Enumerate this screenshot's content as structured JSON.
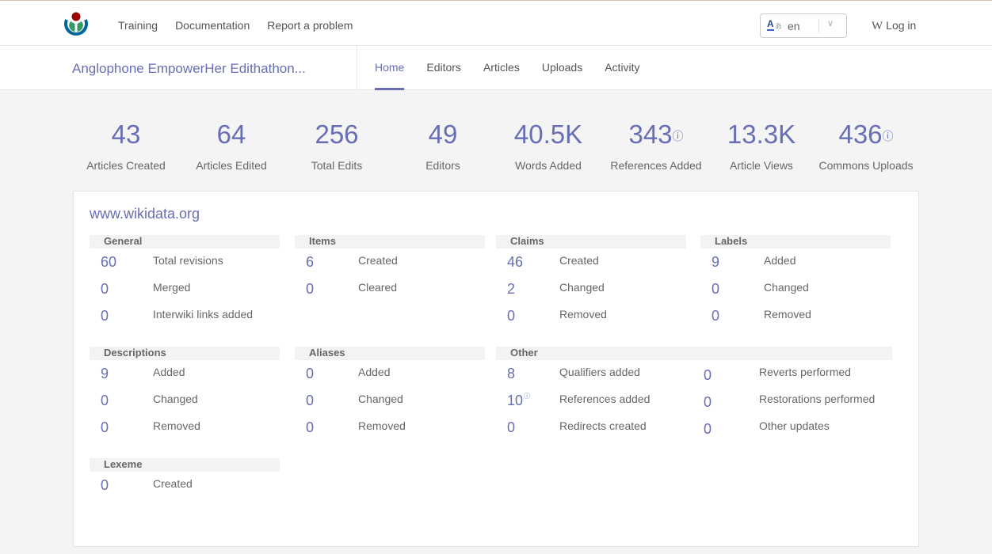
{
  "topbar": {
    "logo": "wikimedia-logo",
    "nav": [
      "Training",
      "Documentation",
      "Report a problem"
    ],
    "language": {
      "icon": "language-icon",
      "code": "en"
    },
    "login": {
      "icon": "wikipedia-w-icon",
      "w": "W",
      "label": "Log in"
    }
  },
  "campaign": {
    "title": "Anglophone EmpowerHer Edithathon...",
    "tabs": [
      {
        "label": "Home",
        "active": true
      },
      {
        "label": "Editors",
        "active": false
      },
      {
        "label": "Articles",
        "active": false
      },
      {
        "label": "Uploads",
        "active": false
      },
      {
        "label": "Activity",
        "active": false
      }
    ]
  },
  "stats": [
    {
      "value": "43",
      "label": "Articles Created",
      "info": false
    },
    {
      "value": "64",
      "label": "Articles Edited",
      "info": false
    },
    {
      "value": "256",
      "label": "Total Edits",
      "info": false
    },
    {
      "value": "49",
      "label": "Editors",
      "info": false
    },
    {
      "value": "40.5K",
      "label": "Words Added",
      "info": false
    },
    {
      "value": "343",
      "label": "References Added",
      "info": true
    },
    {
      "value": "13.3K",
      "label": "Article Views",
      "info": false
    },
    {
      "value": "436",
      "label": "Commons Uploads",
      "info": true
    }
  ],
  "info_glyph": "ⓘ",
  "wiki": {
    "site": "www.wikidata.org",
    "groups": {
      "general": {
        "title": "General",
        "rows": [
          {
            "value": "60",
            "label": "Total revisions"
          },
          {
            "value": "0",
            "label": "Merged"
          },
          {
            "value": "0",
            "label": "Interwiki links added"
          }
        ]
      },
      "items": {
        "title": "Items",
        "rows": [
          {
            "value": "6",
            "label": "Created"
          },
          {
            "value": "0",
            "label": "Cleared"
          }
        ]
      },
      "claims": {
        "title": "Claims",
        "rows": [
          {
            "value": "46",
            "label": "Created"
          },
          {
            "value": "2",
            "label": "Changed"
          },
          {
            "value": "0",
            "label": "Removed"
          }
        ]
      },
      "labels": {
        "title": "Labels",
        "rows": [
          {
            "value": "9",
            "label": "Added"
          },
          {
            "value": "0",
            "label": "Changed"
          },
          {
            "value": "0",
            "label": "Removed"
          }
        ]
      },
      "descriptions": {
        "title": "Descriptions",
        "rows": [
          {
            "value": "9",
            "label": "Added"
          },
          {
            "value": "0",
            "label": "Changed"
          },
          {
            "value": "0",
            "label": "Removed"
          }
        ]
      },
      "aliases": {
        "title": "Aliases",
        "rows": [
          {
            "value": "0",
            "label": "Added"
          },
          {
            "value": "0",
            "label": "Changed"
          },
          {
            "value": "0",
            "label": "Removed"
          }
        ]
      },
      "other": {
        "title": "Other",
        "rows": [
          {
            "value": "8",
            "label": "Qualifiers added",
            "value2": "0",
            "label2": "Reverts performed"
          },
          {
            "value": "10",
            "info": true,
            "label": "References added",
            "value2": "0",
            "label2": "Restorations performed"
          },
          {
            "value": "0",
            "label": "Redirects created",
            "value2": "0",
            "label2": "Other updates"
          }
        ]
      },
      "lexeme": {
        "title": "Lexeme",
        "rows": [
          {
            "value": "0",
            "label": "Created"
          }
        ]
      }
    }
  },
  "colors": {
    "accent": "#676eb4",
    "text": "#666666",
    "background": "#f4f4f4"
  }
}
